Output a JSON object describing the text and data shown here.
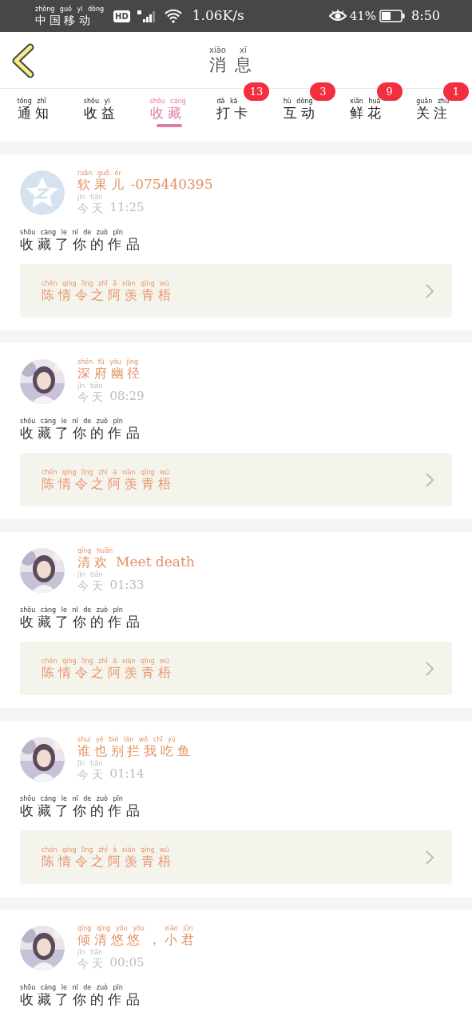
{
  "status_bar": {
    "carrier": [
      {
        "text": "中国移动",
        "pinyin": "zhōng guó yí dòng"
      }
    ],
    "network": "HD",
    "speed": "1.06K/s",
    "battery": "41%",
    "time": "8:50"
  },
  "header": {
    "title": [
      {
        "text": "消息",
        "pinyin": "xiāo xī"
      }
    ]
  },
  "tabs": [
    {
      "label": [
        {
          "text": "通知",
          "pinyin": "tōng zhī"
        }
      ],
      "selected": false
    },
    {
      "label": [
        {
          "text": "收益",
          "pinyin": "shōu yì"
        }
      ],
      "selected": false
    },
    {
      "label": [
        {
          "text": "收藏",
          "pinyin": "shōu cáng"
        }
      ],
      "selected": true
    },
    {
      "label": [
        {
          "text": "打卡",
          "pinyin": "dǎ kǎ"
        }
      ],
      "selected": false,
      "badge": "13"
    },
    {
      "label": [
        {
          "text": "互动",
          "pinyin": "hù dòng"
        }
      ],
      "selected": false,
      "badge": "3"
    },
    {
      "label": [
        {
          "text": "鲜花",
          "pinyin": "xiān huā"
        }
      ],
      "selected": false,
      "badge": "9"
    },
    {
      "label": [
        {
          "text": "关注",
          "pinyin": "guān zhù"
        }
      ],
      "selected": false,
      "badge": "1"
    }
  ],
  "messages": [
    {
      "avatar": {
        "kind": "default"
      },
      "name": [
        {
          "text": "软果儿",
          "pinyin": "ruǎn guǒ ér"
        },
        {
          "text": "-075440395"
        }
      ],
      "time": [
        {
          "text": "今天",
          "pinyin": "jīn tiān"
        },
        {
          "text": "11:25"
        }
      ],
      "action": [
        {
          "text": "收藏了你的作品",
          "pinyin": "shōu cáng le nǐ de zuò pǐn"
        }
      ],
      "work": [
        {
          "text": "陈情令之阿羡青梧",
          "pinyin": "chén qíng lìng zhī ā xiàn qīng wú"
        }
      ]
    },
    {
      "avatar": {
        "kind": "picture"
      },
      "name": [
        {
          "text": "深府幽径",
          "pinyin": "shēn fǔ yōu jìng"
        }
      ],
      "time": [
        {
          "text": "今天",
          "pinyin": "jīn tiān"
        },
        {
          "text": "08:29"
        }
      ],
      "action": [
        {
          "text": "收藏了你的作品",
          "pinyin": "shōu cáng le nǐ de zuò pǐn"
        }
      ],
      "work": [
        {
          "text": "陈情令之阿羡青梧",
          "pinyin": "chén qíng lìng zhī ā xiàn qīng wú"
        }
      ]
    },
    {
      "avatar": {
        "kind": "picture"
      },
      "name": [
        {
          "text": "清欢",
          "pinyin": "qīng huān"
        },
        {
          "text": "Meet death"
        }
      ],
      "time": [
        {
          "text": "今天",
          "pinyin": "jīn tiān"
        },
        {
          "text": "01:33"
        }
      ],
      "action": [
        {
          "text": "收藏了你的作品",
          "pinyin": "shōu cáng le nǐ de zuò pǐn"
        }
      ],
      "work": [
        {
          "text": "陈情令之阿羡青梧",
          "pinyin": "chén qíng lìng zhī ā xiàn qīng wú"
        }
      ]
    },
    {
      "avatar": {
        "kind": "picture"
      },
      "name": [
        {
          "text": "谁也别拦我吃鱼",
          "pinyin": "shuí yě bié lán wǒ chī yú"
        }
      ],
      "time": [
        {
          "text": "今天",
          "pinyin": "jīn tiān"
        },
        {
          "text": "01:14"
        }
      ],
      "action": [
        {
          "text": "收藏了你的作品",
          "pinyin": "shōu cáng le nǐ de zuò pǐn"
        }
      ],
      "work": [
        {
          "text": "陈情令之阿羡青梧",
          "pinyin": "chén qíng lìng zhī ā xiàn qīng wú"
        }
      ]
    },
    {
      "avatar": {
        "kind": "picture"
      },
      "name": [
        {
          "text": "倾清悠悠",
          "pinyin": "qīng qīng yōu yōu"
        },
        {
          "text": "，"
        },
        {
          "text": "小君",
          "pinyin": "xiǎo jūn"
        }
      ],
      "time": [
        {
          "text": "今天",
          "pinyin": "jīn tiān"
        },
        {
          "text": "00:05"
        }
      ],
      "action": [
        {
          "text": "收藏了你的作品",
          "pinyin": "shōu cáng le nǐ de zuò pǐn"
        }
      ]
    }
  ]
}
